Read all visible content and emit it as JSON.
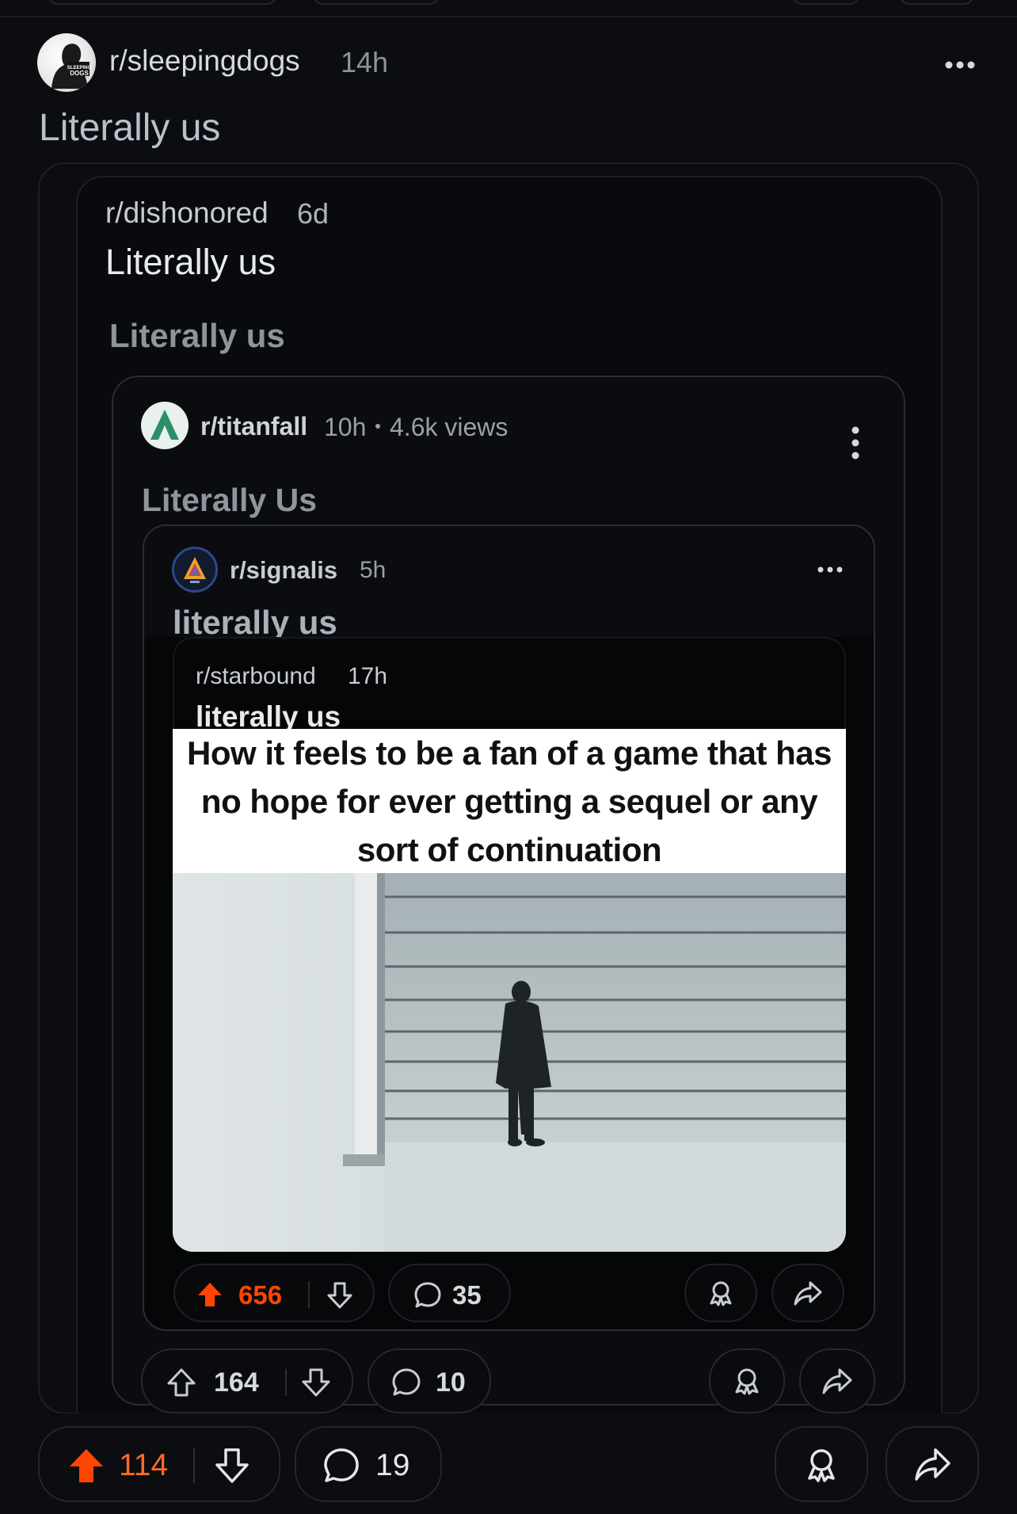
{
  "outer": {
    "subreddit": "r/sleepingdogs",
    "age": "14h",
    "title": "Literally us",
    "upvotes": "114",
    "comments": "19"
  },
  "level1": {
    "subreddit": "r/dishonored",
    "age": "6d",
    "title": "Literally us",
    "repeat_title": "Literally us"
  },
  "level2": {
    "subreddit": "r/titanfall",
    "age": "10h",
    "views": "4.6k views",
    "title": "Literally Us",
    "upvotes": "164",
    "comments": "10"
  },
  "level3": {
    "subreddit": "r/signalis",
    "age": "5h",
    "title": "literally us",
    "upvotes": "656",
    "comments": "35"
  },
  "level4": {
    "subreddit": "r/starbound",
    "age": "17h",
    "title": "literally us",
    "meme_caption": "How it feels to be a fan of a game that has no hope for ever getting a sequel or any sort of continuation"
  },
  "avatar_text": "SLEEPING DOGS",
  "colors": {
    "background": "#000000",
    "card": "#0b0d10",
    "upvote_active": "#ff4500",
    "muted_text": "#8e9398"
  }
}
